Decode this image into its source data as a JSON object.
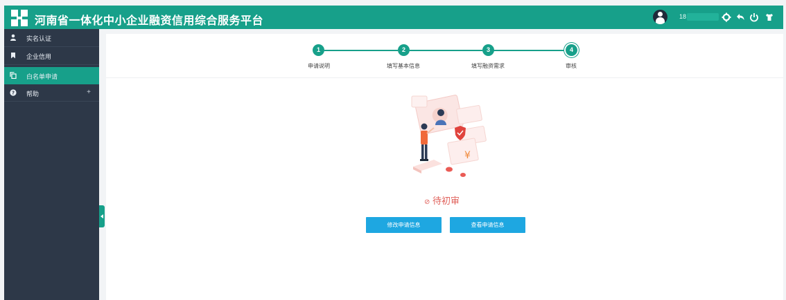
{
  "header": {
    "title": "河南省一体化中小企业融资信用综合服务平台",
    "user_prefix": "18",
    "icons": [
      "gear-icon",
      "back-icon",
      "power-icon",
      "shirt-icon"
    ]
  },
  "sidebar": {
    "items": [
      {
        "label": "实名认证",
        "icon": "user-icon"
      },
      {
        "label": "企业信用",
        "icon": "bookmark-icon"
      },
      {
        "label": "白名单申请",
        "icon": "copy-icon",
        "active": true
      },
      {
        "label": "帮助",
        "icon": "help-icon",
        "expand": "+"
      }
    ]
  },
  "steps": {
    "items": [
      {
        "number": "1",
        "label": "申请说明"
      },
      {
        "number": "2",
        "label": "填写基本信息"
      },
      {
        "number": "3",
        "label": "填写融资需求"
      },
      {
        "number": "4",
        "label": "审核",
        "current": true
      }
    ]
  },
  "status": {
    "icon": "⊘",
    "text": "待初审"
  },
  "buttons": {
    "edit": "修改申请信息",
    "view": "查看申请信息"
  },
  "illustration": {
    "currency_symbol": "¥"
  },
  "colors": {
    "brand": "#17a08a",
    "sidebar_bg": "#2d3848",
    "button": "#1ea7e1",
    "status": "#e0605a"
  }
}
